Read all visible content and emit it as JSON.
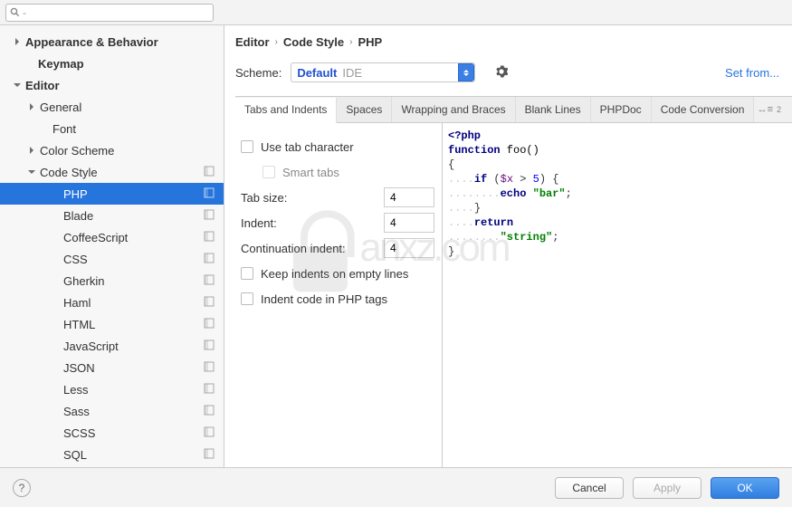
{
  "search": {
    "placeholder": ""
  },
  "sidebar": {
    "items": [
      {
        "label": "Appearance & Behavior",
        "indent": 14,
        "bold": true,
        "arrow": "right",
        "icon": false
      },
      {
        "label": "Keymap",
        "indent": 28,
        "bold": true,
        "arrow": "none",
        "icon": false
      },
      {
        "label": "Editor",
        "indent": 14,
        "bold": true,
        "arrow": "down",
        "icon": false
      },
      {
        "label": "General",
        "indent": 30,
        "bold": false,
        "arrow": "right",
        "icon": false
      },
      {
        "label": "Font",
        "indent": 44,
        "bold": false,
        "arrow": "none",
        "icon": false
      },
      {
        "label": "Color Scheme",
        "indent": 30,
        "bold": false,
        "arrow": "right",
        "icon": false
      },
      {
        "label": "Code Style",
        "indent": 30,
        "bold": false,
        "arrow": "down",
        "icon": true
      },
      {
        "label": "PHP",
        "indent": 56,
        "bold": false,
        "arrow": "none",
        "icon": true,
        "selected": true
      },
      {
        "label": "Blade",
        "indent": 56,
        "bold": false,
        "arrow": "none",
        "icon": true
      },
      {
        "label": "CoffeeScript",
        "indent": 56,
        "bold": false,
        "arrow": "none",
        "icon": true
      },
      {
        "label": "CSS",
        "indent": 56,
        "bold": false,
        "arrow": "none",
        "icon": true
      },
      {
        "label": "Gherkin",
        "indent": 56,
        "bold": false,
        "arrow": "none",
        "icon": true
      },
      {
        "label": "Haml",
        "indent": 56,
        "bold": false,
        "arrow": "none",
        "icon": true
      },
      {
        "label": "HTML",
        "indent": 56,
        "bold": false,
        "arrow": "none",
        "icon": true
      },
      {
        "label": "JavaScript",
        "indent": 56,
        "bold": false,
        "arrow": "none",
        "icon": true
      },
      {
        "label": "JSON",
        "indent": 56,
        "bold": false,
        "arrow": "none",
        "icon": true
      },
      {
        "label": "Less",
        "indent": 56,
        "bold": false,
        "arrow": "none",
        "icon": true
      },
      {
        "label": "Sass",
        "indent": 56,
        "bold": false,
        "arrow": "none",
        "icon": true
      },
      {
        "label": "SCSS",
        "indent": 56,
        "bold": false,
        "arrow": "none",
        "icon": true
      },
      {
        "label": "SQL",
        "indent": 56,
        "bold": false,
        "arrow": "none",
        "icon": true
      }
    ]
  },
  "breadcrumb": [
    "Editor",
    "Code Style",
    "PHP"
  ],
  "scheme": {
    "label": "Scheme:",
    "value_main": "Default",
    "value_sub": "IDE",
    "set_from": "Set from..."
  },
  "tabs": [
    "Tabs and Indents",
    "Spaces",
    "Wrapping and Braces",
    "Blank Lines",
    "PHPDoc",
    "Code Conversion"
  ],
  "active_tab": 0,
  "form": {
    "use_tab": "Use tab character",
    "smart_tabs": "Smart tabs",
    "tab_size_label": "Tab size:",
    "tab_size_value": "4",
    "indent_label": "Indent:",
    "indent_value": "4",
    "cont_label": "Continuation indent:",
    "cont_value": "4",
    "keep_indents": "Keep indents on empty lines",
    "indent_php": "Indent code in PHP tags"
  },
  "preview": {
    "l1_a": "<?php",
    "l2_a": "function",
    "l2_b": " foo()",
    "l3": "{",
    "l4_a": "if",
    "l4_b": " (",
    "l4_c": "$x",
    "l4_d": " > ",
    "l4_e": "5",
    "l4_f": ") {",
    "l5_a": "echo",
    "l5_b": " ",
    "l5_c": "\"bar\"",
    "l5_d": ";",
    "l6": "}",
    "l7": "return",
    "l8_a": "\"string\"",
    "l8_b": ";",
    "l9": "}"
  },
  "footer": {
    "cancel": "Cancel",
    "apply": "Apply",
    "ok": "OK"
  },
  "watermark": "anxz.com"
}
